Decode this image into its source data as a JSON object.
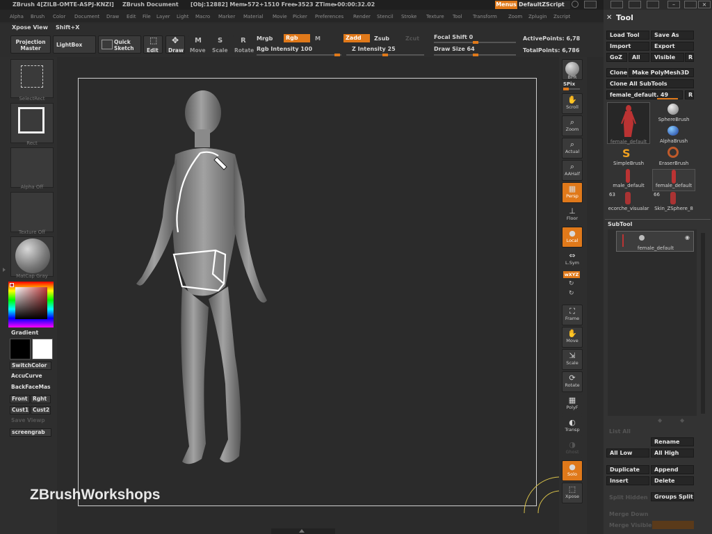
{
  "titlebar": {
    "app": "ZBrush 4[ZILB-OMTE-ASPJ-KNZI]",
    "doc": "ZBrush Document",
    "stats": "[Obj:12882] Mem▸572+1510 Free▸3523 ZTime▸00:00:32.02",
    "menus_btn": "Menus",
    "script": "DefaultZScript"
  },
  "menubar": [
    "Alpha",
    "Brush",
    "Color",
    "Document",
    "Draw",
    "Edit",
    "File",
    "Layer",
    "Light",
    "Macro",
    "Marker",
    "Material",
    "Movie",
    "Picker",
    "Preferences",
    "Render",
    "Stencil",
    "Stroke",
    "Texture",
    "Tool",
    "Transform",
    "Zoom",
    "Zplugin",
    "Zscript"
  ],
  "toolbar": {
    "xpose": "Xpose View",
    "shortcut": "Shift+X",
    "projection": "Projection\nMaster",
    "lightbox": "LightBox",
    "quick_sketch": "Quick\nSketch",
    "edit": "Edit",
    "draw": "Draw",
    "move": "Move",
    "scale": "Scale",
    "rotate": "Rotate",
    "mrgb": "Mrgb",
    "rgb": "Rgb",
    "m": "M",
    "rgb_intensity": "Rgb Intensity 100",
    "zadd": "Zadd",
    "zsub": "Zsub",
    "zcut": "Zcut",
    "z_intensity": "Z Intensity 25",
    "focal_shift": "Focal Shift 0",
    "draw_size": "Draw Size 64",
    "active_points": "ActivePoints: 6,78",
    "total_points": "TotalPoints: 6,786"
  },
  "leftshelf": {
    "select_rect": "SelectRect",
    "rect": "Rect",
    "alpha": "Alpha  Off",
    "texture": "Texture  Off",
    "matcap": "MatCap Gray",
    "gradient": "Gradient",
    "switch_color": "SwitchColor",
    "accucurve": "AccuCurve",
    "backface": "BackFaceMas",
    "front": "Front",
    "right": "Rght",
    "cust1": "Cust1",
    "cust2": "Cust2",
    "save_viewpoint": "Save Viewp",
    "screengrab": "screengrab"
  },
  "rightshelf": {
    "bpr": "BPR",
    "spix": "SPix",
    "scroll": "Scroll",
    "zoom": "Zoom",
    "actual": "Actual",
    "aahalf": "AAHalf",
    "persp": "Persp",
    "floor": "Floor",
    "local": "Local",
    "lsym": "L.Sym",
    "xyz": "wXYZ",
    "frame": "Frame",
    "move": "Move",
    "scale": "Scale",
    "rotate": "Rotate",
    "polyf": "PolyF",
    "transp": "Transp",
    "ghost": "Ghost",
    "solo": "Solo",
    "xpose": "Xpose"
  },
  "toolpanel": {
    "title": "Tool",
    "load_tool": "Load Tool",
    "save_as": "Save As",
    "import": "Import",
    "export": "Export",
    "goz": "GoZ",
    "all": "All",
    "visible": "Visible",
    "r": "R",
    "clone": "Clone",
    "make_polymesh": "Make PolyMesh3D",
    "clone_all": "Clone All SubTools",
    "current_tool": "female_default. 49",
    "tools": [
      {
        "label": "female_default"
      },
      {
        "label": "SphereBrush"
      },
      {
        "label": "AlphaBrush"
      },
      {
        "label": "SimpleBrush"
      },
      {
        "label": "EraserBrush"
      },
      {
        "label": "male_default"
      },
      {
        "label": "female_default"
      },
      {
        "label": "ecorche_visualar"
      },
      {
        "label": "Skin_ZSphere_8"
      }
    ],
    "count_63": "63",
    "count_66": "66",
    "subtool_title": "SubTool",
    "subtool_item": "female_default",
    "list_all": "List All",
    "rename": "Rename",
    "all_low": "All Low",
    "all_high": "All High",
    "duplicate": "Duplicate",
    "append": "Append",
    "insert": "Insert",
    "delete": "Delete",
    "split_hidden": "Split Hidden",
    "groups_split": "Groups Split",
    "merge_down": "Merge Down",
    "merge_visible": "Merge Visible"
  },
  "watermark": "ZBrushWorkshops",
  "colors": {
    "accent": "#e0791a",
    "panel": "#333333",
    "canvas": "#2b2b2b"
  }
}
